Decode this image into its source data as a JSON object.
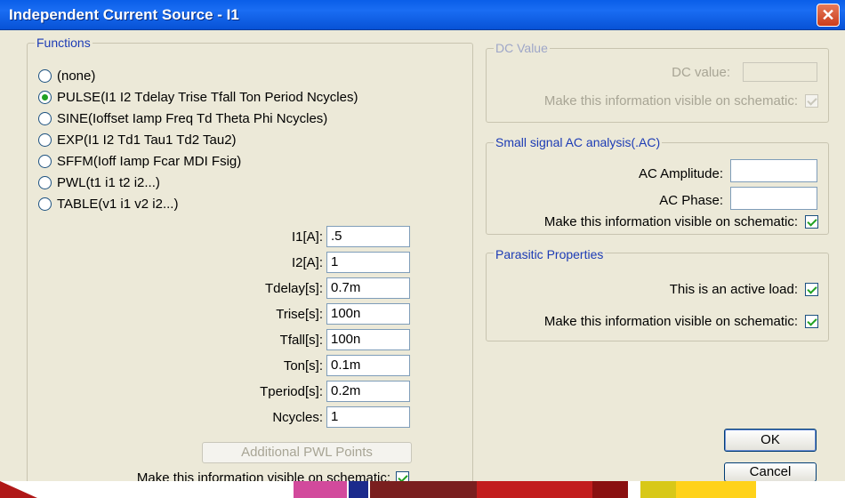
{
  "window": {
    "title": "Independent Current Source - I1",
    "close_label": "✕"
  },
  "functions": {
    "legend": "Functions",
    "options": [
      {
        "label": "(none)",
        "selected": false
      },
      {
        "label": "PULSE(I1 I2 Tdelay Trise Tfall Ton Period Ncycles)",
        "selected": true
      },
      {
        "label": "SINE(Ioffset Iamp Freq Td Theta Phi Ncycles)",
        "selected": false
      },
      {
        "label": "EXP(I1 I2 Td1 Tau1 Td2 Tau2)",
        "selected": false
      },
      {
        "label": "SFFM(Ioff Iamp Fcar MDI Fsig)",
        "selected": false
      },
      {
        "label": "PWL(t1 i1 t2 i2...)",
        "selected": false
      },
      {
        "label": "TABLE(v1 i1 v2 i2...)",
        "selected": false
      }
    ],
    "params": [
      {
        "label": "I1[A]:",
        "value": ".5"
      },
      {
        "label": "I2[A]:",
        "value": "1"
      },
      {
        "label": "Tdelay[s]:",
        "value": "0.7m"
      },
      {
        "label": "Trise[s]:",
        "value": "100n"
      },
      {
        "label": "Tfall[s]:",
        "value": "100n"
      },
      {
        "label": "Ton[s]:",
        "value": "0.1m"
      },
      {
        "label": "Tperiod[s]:",
        "value": "0.2m"
      },
      {
        "label": "Ncycles:",
        "value": "1"
      }
    ],
    "pwl_button": "Additional PWL Points",
    "visible_label": "Make this information visible on schematic:",
    "visible_checked": true
  },
  "dc": {
    "legend": "DC Value",
    "value_label": "DC value:",
    "value": "",
    "visible_label": "Make this information visible on schematic:",
    "visible_checked": true
  },
  "ac": {
    "legend": "Small signal AC analysis(.AC)",
    "amplitude_label": "AC Amplitude:",
    "amplitude": "",
    "phase_label": "AC Phase:",
    "phase": "",
    "visible_label": "Make this information visible on schematic:",
    "visible_checked": true
  },
  "parasitic": {
    "legend": "Parasitic Properties",
    "active_load_label": "This is an active load:",
    "active_load_checked": true,
    "visible_label": "Make this information visible on schematic:",
    "visible_checked": true
  },
  "buttons": {
    "ok": "OK",
    "cancel": "Cancel"
  },
  "colors": {
    "titlebar": "#0a5ee8",
    "legend": "#1c3bb5",
    "dialog_bg": "#ece9d8"
  }
}
